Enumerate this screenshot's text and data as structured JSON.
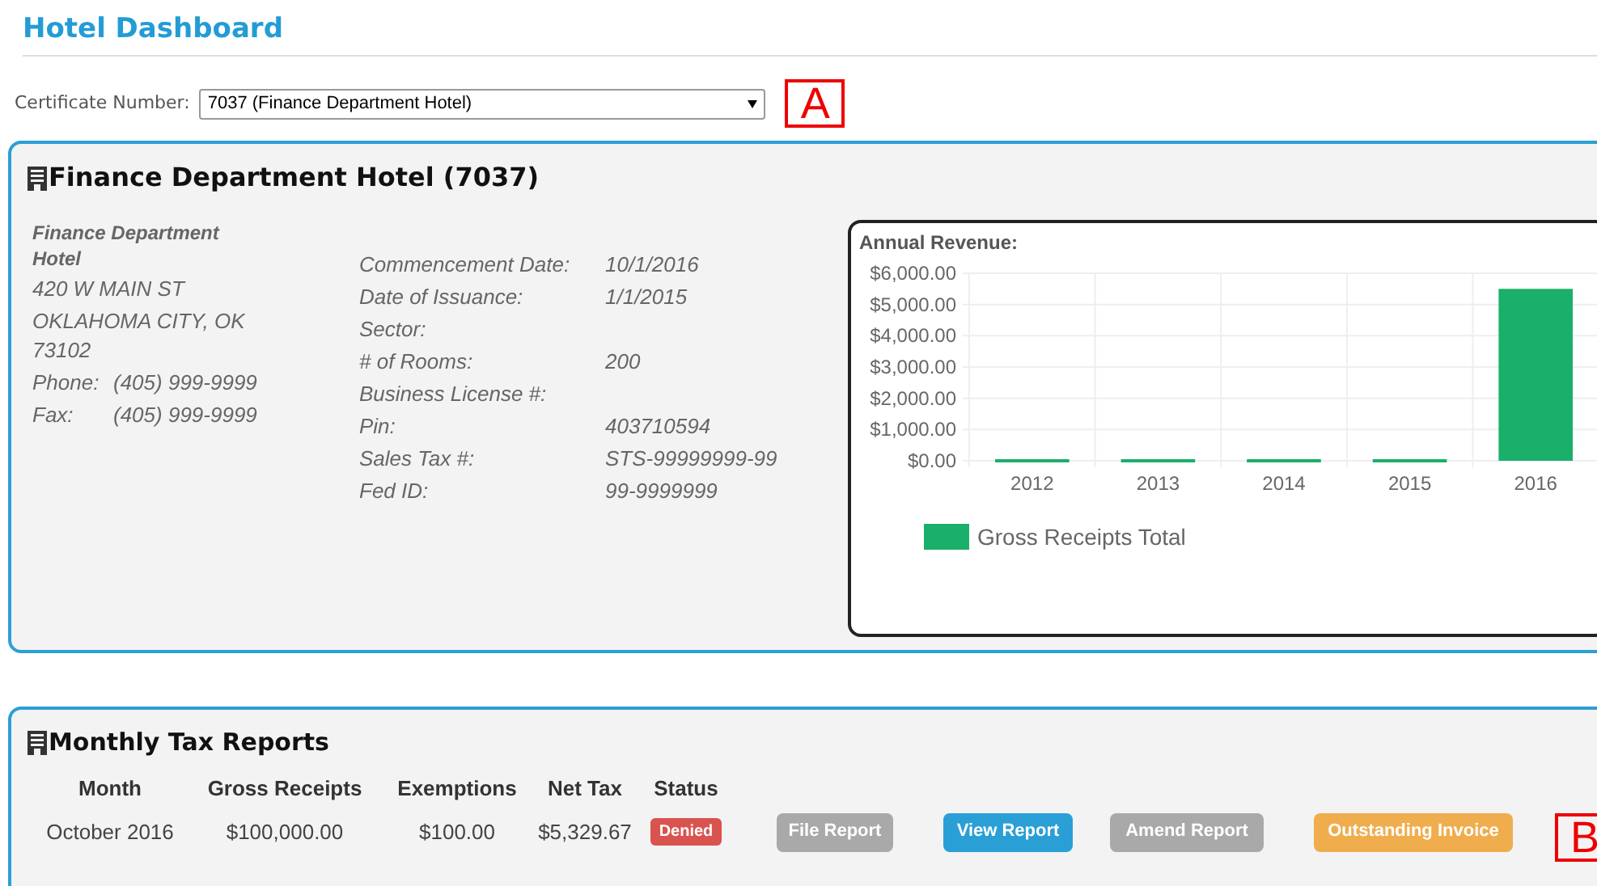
{
  "title": "Hotel Dashboard",
  "certificate": {
    "label": "Certificate Number:",
    "value": "7037 (Finance Department Hotel)",
    "marker": "A"
  },
  "hotel_panel": {
    "title": "Finance Department Hotel (7037)",
    "address": {
      "name": "Finance Department Hotel",
      "lines": [
        "420 W MAIN ST",
        "OKLAHOMA CITY, OK 73102"
      ],
      "phone_label": "Phone:",
      "phone": "(405) 999-9999",
      "fax_label": "Fax:",
      "fax": "(405) 999-9999"
    },
    "details": [
      {
        "label": "Commencement Date:",
        "value": "10/1/2016"
      },
      {
        "label": "Date of Issuance:",
        "value": "1/1/2015"
      },
      {
        "label": "Sector:"
      },
      {
        "label": "# of Rooms:",
        "value": "200"
      },
      {
        "label": "Business License #:"
      },
      {
        "label": "Pin:",
        "value": "403710594"
      },
      {
        "label": "Sales Tax #:",
        "value": "STS-99999999-99"
      },
      {
        "label": "Fed ID:",
        "value": "99-9999999"
      }
    ],
    "chart_data": {
      "type": "bar",
      "title": "Annual Revenue:",
      "categories": [
        "2012",
        "2013",
        "2014",
        "2015",
        "2016"
      ],
      "series": [
        {
          "name": "Gross Receipts Total",
          "color": "#1aaf6a",
          "values": [
            40,
            40,
            40,
            40,
            5500
          ]
        }
      ],
      "ylim": [
        0,
        6000
      ],
      "grid": true,
      "yticks": [
        {
          "value": 0,
          "label": "$0.00"
        },
        {
          "value": 1000,
          "label": "$1,000.00"
        },
        {
          "value": 2000,
          "label": "$2,000.00"
        },
        {
          "value": 3000,
          "label": "$3,000.00"
        },
        {
          "value": 4000,
          "label": "$4,000.00"
        },
        {
          "value": 5000,
          "label": "$5,000.00"
        },
        {
          "value": 6000,
          "label": "$6,000.00"
        }
      ]
    }
  },
  "reports_panel": {
    "title": "Monthly Tax Reports",
    "columns": [
      "Month",
      "Gross Receipts",
      "Exemptions",
      "Net Tax",
      "Status"
    ],
    "rows": [
      {
        "month": "October 2016",
        "gross_receipts": "$100,000.00",
        "exemptions": "$100.00",
        "net_tax": "$5,329.67",
        "status": "Denied",
        "buttons": [
          {
            "label": "File Report",
            "kind": "disabled"
          },
          {
            "label": "View Report",
            "kind": "primary"
          },
          {
            "label": "Amend Report",
            "kind": "disabled"
          },
          {
            "label": "Outstanding Invoice",
            "kind": "warning"
          }
        ]
      }
    ],
    "marker": "B"
  }
}
